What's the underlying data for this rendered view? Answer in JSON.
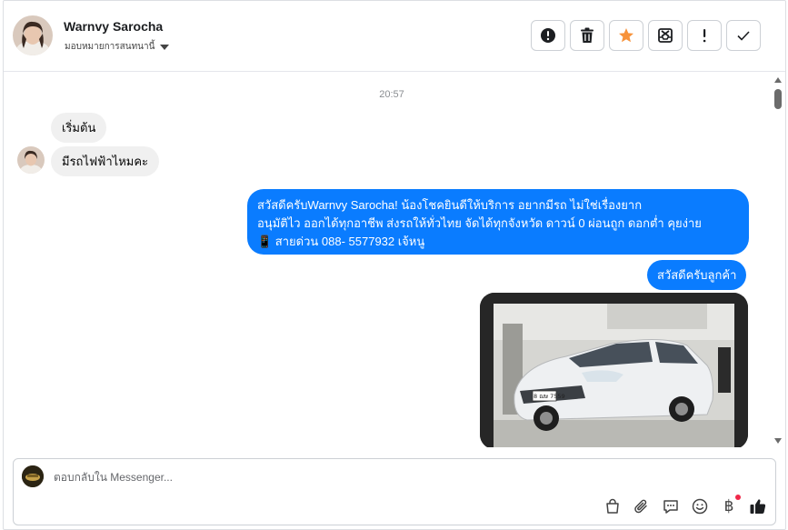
{
  "header": {
    "contact_name": "Warnvy Sarocha",
    "assign_label": "มอบหมายการสนทนานี้",
    "toolbar_icons": [
      "alert-circle-icon",
      "trash-icon",
      "star-icon",
      "mark-spam-icon",
      "exclamation-icon",
      "check-icon"
    ],
    "star_color": "#f7923a"
  },
  "conversation": {
    "timestamp": "20:57",
    "incoming": [
      {
        "text": "เริ่มต้น"
      },
      {
        "text": "มีรถไฟฟ้าไหมคะ"
      }
    ],
    "outgoing": [
      {
        "lines": [
          "สวัสดีครับWarnvy Sarocha! น้องโชคยินดีให้บริการ อยากมีรถ ไม่ใช่เรื่องยาก",
          "อนุมัติไว ออกได้ทุกอาชีพ ส่งรถให้ทั่วไทย จัดได้ทุกจังหวัด ดาวน์ 0  ผ่อนถูก ดอกต่ำ คุยง่าย",
          "📱 สายด่วน 088- 5577932 เจ้หนู"
        ]
      },
      {
        "text": "สวัสดีครับลูกค้า"
      }
    ],
    "photo": {
      "plate_text": "8 ฌษ 7559",
      "car_color": "#eef0f2"
    },
    "outgoing_color": "#0a7cff"
  },
  "composer": {
    "placeholder": "ตอบกลับใน Messenger...",
    "value": "",
    "icons": [
      "shopping-bag-icon",
      "paperclip-icon",
      "saved-reply-icon",
      "emoji-icon",
      "baht-payment-icon",
      "thumbs-up-icon"
    ],
    "baht_symbol": "฿",
    "accent_color": "#1c1e21"
  }
}
